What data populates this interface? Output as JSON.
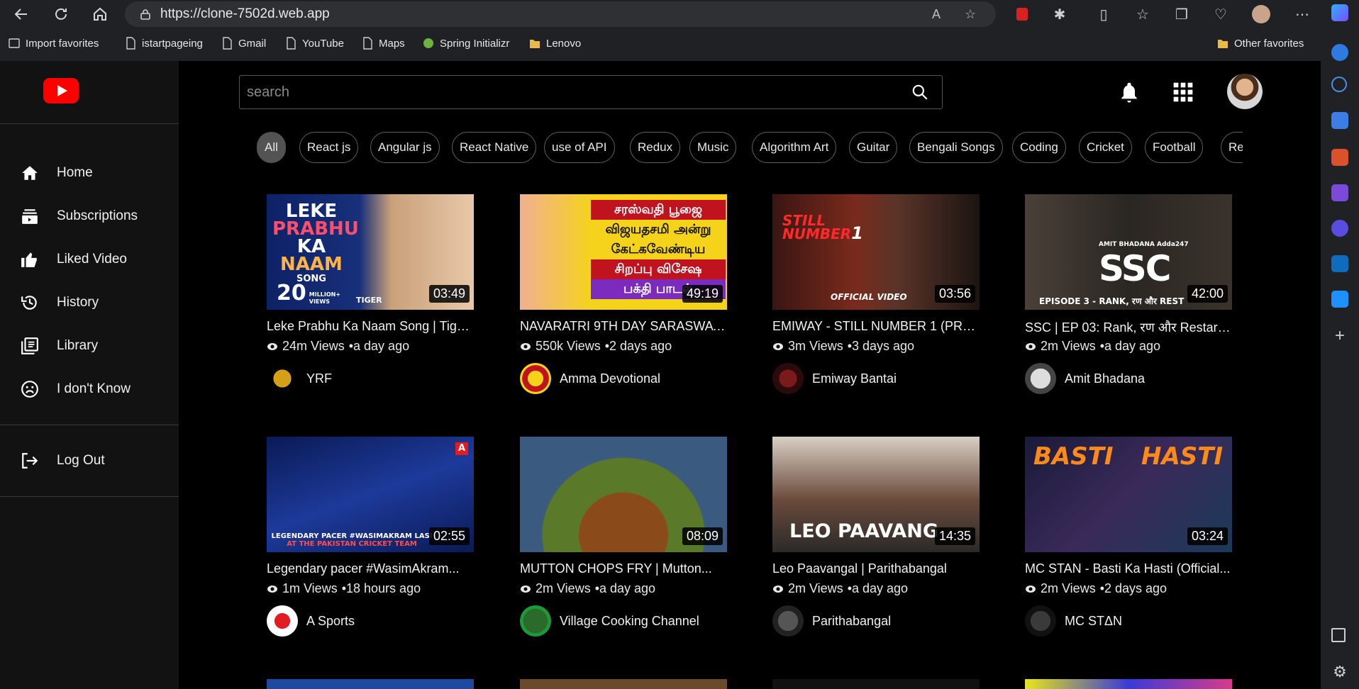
{
  "browser": {
    "url": "https://clone-7502d.web.app",
    "bookmarks": [
      "Import favorites",
      "istartpageing",
      "Gmail",
      "YouTube",
      "Maps",
      "Spring Initializr",
      "Lenovo"
    ],
    "other_favorites": "Other favorites"
  },
  "sidebar": {
    "items": [
      {
        "label": "Home",
        "icon": "home-icon"
      },
      {
        "label": "Subscriptions",
        "icon": "subscriptions-icon"
      },
      {
        "label": "Liked Video",
        "icon": "thumbs-up-icon"
      },
      {
        "label": "History",
        "icon": "history-icon"
      },
      {
        "label": "Library",
        "icon": "library-icon"
      },
      {
        "label": "I don't Know",
        "icon": "sad-face-icon"
      }
    ],
    "logout": "Log Out"
  },
  "search": {
    "placeholder": "search"
  },
  "chips": [
    "All",
    "React js",
    "Angular js",
    "React Native",
    "use of API",
    "Redux",
    "Music",
    "Algorithm Art",
    "Guitar",
    "Bengali Songs",
    "Coding",
    "Cricket",
    "Football",
    "Rea"
  ],
  "videos": [
    {
      "title": "Leke Prabhu Ka Naam Song | Tige...",
      "duration": "03:49",
      "views": "24m Views",
      "age": "•a day ago",
      "channel": "YRF",
      "accent": "#1f3a8a"
    },
    {
      "title": "NAVARATRI 9TH DAY SARASWAT...",
      "duration": "49:19",
      "views": "550k Views",
      "age": "•2 days ago",
      "channel": "Amma Devotional",
      "accent": "#f5d31a"
    },
    {
      "title": "EMIWAY - STILL NUMBER 1 (PRO...",
      "duration": "03:56",
      "views": "3m Views",
      "age": "•3 days ago",
      "channel": "Emiway Bantai",
      "accent": "#2a1b16"
    },
    {
      "title": "SSC | EP 03: Rank, रण और Restart ...",
      "duration": "42:00",
      "views": "2m Views",
      "age": "•a day ago",
      "channel": "Amit Bhadana",
      "accent": "#3a3530"
    },
    {
      "title": "Legendary pacer #WasimAkram...",
      "duration": "02:55",
      "views": "1m Views",
      "age": "•18 hours ago",
      "channel": "A Sports",
      "accent": "#0e2a78"
    },
    {
      "title": "MUTTON CHOPS FRY | Mutton...",
      "duration": "08:09",
      "views": "2m Views",
      "age": "•a day ago",
      "channel": "Village Cooking Channel",
      "accent": "#4a6a2a"
    },
    {
      "title": "Leo Paavangal | Parithabangal",
      "duration": "14:35",
      "views": "2m Views",
      "age": "•a day ago",
      "channel": "Parithabangal",
      "accent": "#6a4a3a"
    },
    {
      "title": "MC STAN - Basti Ka Hasti (Official...",
      "duration": "03:24",
      "views": "2m Views",
      "age": "•2 days ago",
      "channel": "MC STΔN",
      "accent": "#2a2a50"
    }
  ],
  "thumb_text": {
    "t1": [
      "LEKE",
      "PRABHU",
      "KA",
      "NAAM",
      "SONG",
      "20",
      "MILLION+",
      "VIEWS",
      "TIGER"
    ],
    "t2": [
      "சரஸ்வதி பூஜை",
      "விஜயதசமி அன்று",
      "கேட்கவேண்டிய",
      "சிறப்பு விசேஷ",
      "பக்தி பாடல்"
    ],
    "t3": [
      "STILL",
      "NUMBER",
      "1",
      "OFFICIAL VIDEO"
    ],
    "t4": [
      "AMIT BHADANA",
      "Adda247",
      "SSC",
      "EPISODE 3 - RANK, रण और REST"
    ],
    "t5": [
      "LEGENDARY PACER #WASIMAKRAM LASI",
      "AT THE PAKISTAN CRICKET TEAM",
      "A"
    ],
    "t7": [
      "LEO PAAVANG"
    ],
    "t8": [
      "BASTI",
      "HASTI"
    ]
  }
}
